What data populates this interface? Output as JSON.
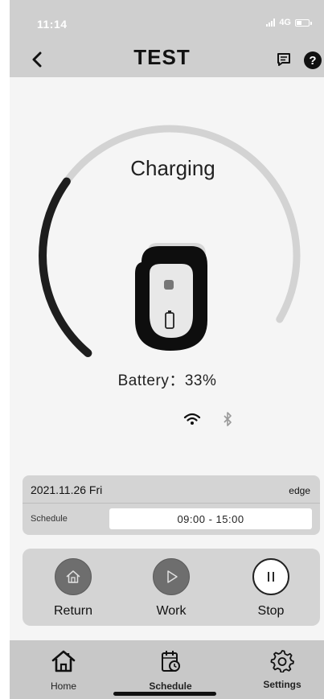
{
  "status_bar": {
    "time": "11:14",
    "network": "4G",
    "battery_level_percent": 35
  },
  "header": {
    "title": "TEST",
    "back_icon": "chevron-left-icon",
    "message_icon": "message-icon",
    "help_label": "?"
  },
  "device": {
    "state": "Charging",
    "battery_label": "Battery：",
    "battery_value": "33%",
    "battery_percent": 33,
    "wifi_icon": "wifi-icon",
    "bluetooth_icon": "bluetooth-icon"
  },
  "info_card": {
    "date": "2021.11.26 Fri",
    "mode": "edge",
    "schedule_label": "Schedule",
    "schedule_value": "09:00 - 15:00"
  },
  "controls": [
    {
      "label": "Return",
      "icon": "home-icon"
    },
    {
      "label": "Work",
      "icon": "play-icon"
    },
    {
      "label": "Stop",
      "icon": "pause-icon"
    }
  ],
  "tabbar": [
    {
      "label": "Home",
      "icon": "home-icon",
      "active": true
    },
    {
      "label": "Schedule",
      "icon": "calendar-clock-icon",
      "active": false
    },
    {
      "label": "Settings",
      "icon": "gear-icon",
      "active": false
    }
  ],
  "colors": {
    "accent": "#111111",
    "track": "#d4d4d4",
    "panel": "#d4d4d4"
  }
}
